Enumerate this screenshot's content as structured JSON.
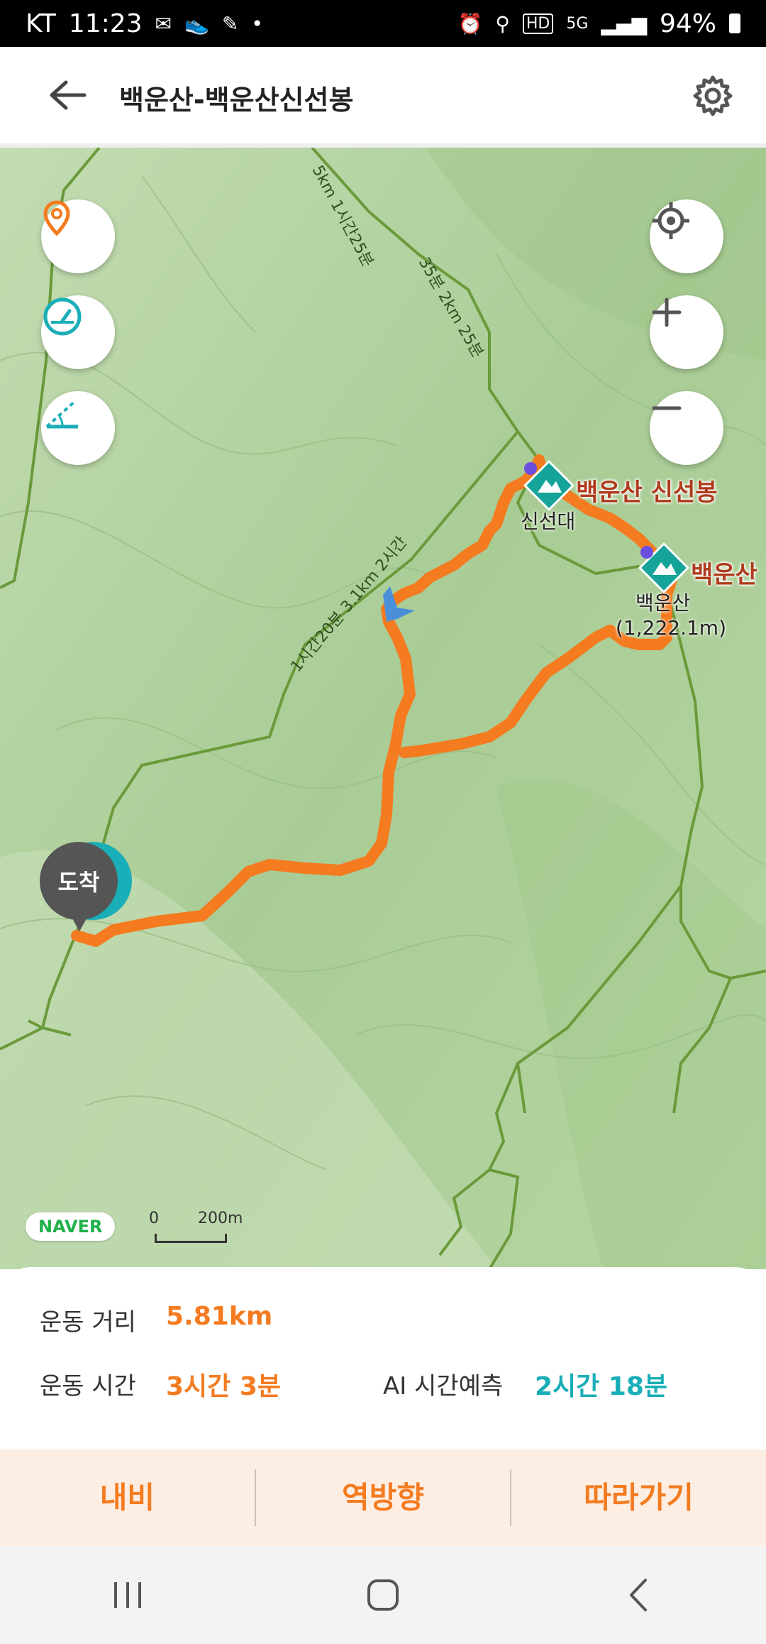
{
  "status": {
    "carrier": "KT",
    "time": "11:23",
    "battery": "94%",
    "network": "5G",
    "hd": "HD"
  },
  "header": {
    "title": "백운산-백운산신선봉"
  },
  "map": {
    "peak_label_1": "백운산 신선봉",
    "peak_label_2": "백운산",
    "sub_label_1": "신선대",
    "sub_label_2": "백운산",
    "sub_label_2_elev": "(1,222.1m)",
    "trail_text_1": "5km 1시간25분",
    "trail_text_2": "35분 2km 25분",
    "trail_text_3": "1시간20분 3.1km 2시간",
    "arrival_marker": "도착",
    "naver_logo": "NAVER",
    "scale_zero": "0",
    "scale_label": "200m",
    "route_color": "#f47b20",
    "trail_color": "#6a9a3a"
  },
  "stats": {
    "distance_label": "운동 거리",
    "distance_value": "5.81km",
    "time_label": "운동 시간",
    "time_value": "3시간 3분",
    "ai_label": "AI 시간예측",
    "ai_value": "2시간 18분"
  },
  "actions": {
    "nav_label": "내비",
    "reverse_label": "역방향",
    "follow_label": "따라가기"
  }
}
